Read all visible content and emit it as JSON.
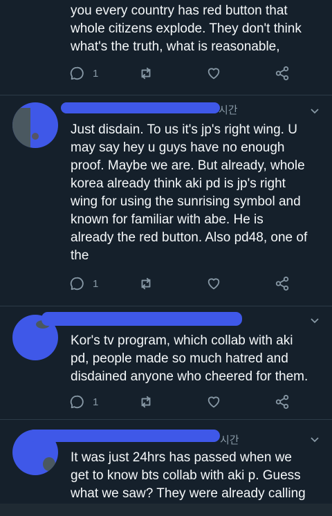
{
  "tweets": [
    {
      "text_lines": [
        "you every country has red button that",
        "whole citizens explode. They don't think",
        "what's the truth, what is reasonable,"
      ],
      "reply_count": "1"
    },
    {
      "time": "시간",
      "text_lines": [
        "Just disdain. To us it's jp's right wing. U",
        "may say hey u guys have no enough",
        "proof. Maybe we are. But already, whole",
        "korea already think aki pd is jp's right",
        "wing for using the sunrising symbol and",
        "known for familiar with abe. He is",
        "already the red button. Also pd48, one of",
        "the"
      ],
      "reply_count": "1"
    },
    {
      "text_lines": [
        "Kor's tv program, which collab with aki",
        "pd, people made so much hatred and",
        "disdained anyone who cheered for them."
      ],
      "reply_count": "1"
    },
    {
      "time": "시간",
      "text_lines": [
        "It was just 24hrs has passed when we",
        "get to know bts collab with aki p. Guess",
        "what we saw? They were already calling"
      ]
    }
  ],
  "icons": [
    "reply-icon",
    "retweet-icon",
    "like-icon",
    "share-icon",
    "chevron-down-icon"
  ],
  "colors": {
    "background": "#15202b",
    "text": "#f5f8fa",
    "muted": "#8899a6",
    "redaction": "#3f58e8"
  }
}
